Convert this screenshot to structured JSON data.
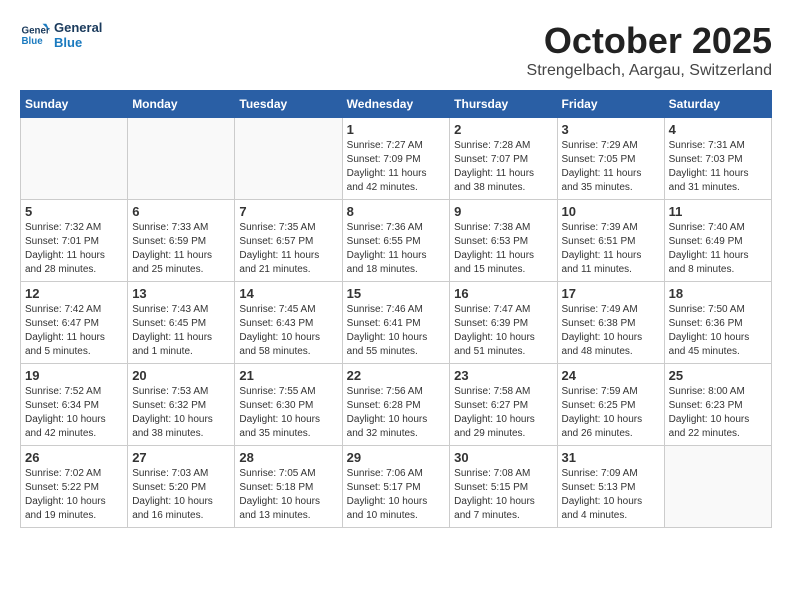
{
  "header": {
    "logo_line1": "General",
    "logo_line2": "Blue",
    "month": "October 2025",
    "location": "Strengelbach, Aargau, Switzerland"
  },
  "weekdays": [
    "Sunday",
    "Monday",
    "Tuesday",
    "Wednesday",
    "Thursday",
    "Friday",
    "Saturday"
  ],
  "weeks": [
    [
      {
        "day": "",
        "info": ""
      },
      {
        "day": "",
        "info": ""
      },
      {
        "day": "",
        "info": ""
      },
      {
        "day": "1",
        "info": "Sunrise: 7:27 AM\nSunset: 7:09 PM\nDaylight: 11 hours\nand 42 minutes."
      },
      {
        "day": "2",
        "info": "Sunrise: 7:28 AM\nSunset: 7:07 PM\nDaylight: 11 hours\nand 38 minutes."
      },
      {
        "day": "3",
        "info": "Sunrise: 7:29 AM\nSunset: 7:05 PM\nDaylight: 11 hours\nand 35 minutes."
      },
      {
        "day": "4",
        "info": "Sunrise: 7:31 AM\nSunset: 7:03 PM\nDaylight: 11 hours\nand 31 minutes."
      }
    ],
    [
      {
        "day": "5",
        "info": "Sunrise: 7:32 AM\nSunset: 7:01 PM\nDaylight: 11 hours\nand 28 minutes."
      },
      {
        "day": "6",
        "info": "Sunrise: 7:33 AM\nSunset: 6:59 PM\nDaylight: 11 hours\nand 25 minutes."
      },
      {
        "day": "7",
        "info": "Sunrise: 7:35 AM\nSunset: 6:57 PM\nDaylight: 11 hours\nand 21 minutes."
      },
      {
        "day": "8",
        "info": "Sunrise: 7:36 AM\nSunset: 6:55 PM\nDaylight: 11 hours\nand 18 minutes."
      },
      {
        "day": "9",
        "info": "Sunrise: 7:38 AM\nSunset: 6:53 PM\nDaylight: 11 hours\nand 15 minutes."
      },
      {
        "day": "10",
        "info": "Sunrise: 7:39 AM\nSunset: 6:51 PM\nDaylight: 11 hours\nand 11 minutes."
      },
      {
        "day": "11",
        "info": "Sunrise: 7:40 AM\nSunset: 6:49 PM\nDaylight: 11 hours\nand 8 minutes."
      }
    ],
    [
      {
        "day": "12",
        "info": "Sunrise: 7:42 AM\nSunset: 6:47 PM\nDaylight: 11 hours\nand 5 minutes."
      },
      {
        "day": "13",
        "info": "Sunrise: 7:43 AM\nSunset: 6:45 PM\nDaylight: 11 hours\nand 1 minute."
      },
      {
        "day": "14",
        "info": "Sunrise: 7:45 AM\nSunset: 6:43 PM\nDaylight: 10 hours\nand 58 minutes."
      },
      {
        "day": "15",
        "info": "Sunrise: 7:46 AM\nSunset: 6:41 PM\nDaylight: 10 hours\nand 55 minutes."
      },
      {
        "day": "16",
        "info": "Sunrise: 7:47 AM\nSunset: 6:39 PM\nDaylight: 10 hours\nand 51 minutes."
      },
      {
        "day": "17",
        "info": "Sunrise: 7:49 AM\nSunset: 6:38 PM\nDaylight: 10 hours\nand 48 minutes."
      },
      {
        "day": "18",
        "info": "Sunrise: 7:50 AM\nSunset: 6:36 PM\nDaylight: 10 hours\nand 45 minutes."
      }
    ],
    [
      {
        "day": "19",
        "info": "Sunrise: 7:52 AM\nSunset: 6:34 PM\nDaylight: 10 hours\nand 42 minutes."
      },
      {
        "day": "20",
        "info": "Sunrise: 7:53 AM\nSunset: 6:32 PM\nDaylight: 10 hours\nand 38 minutes."
      },
      {
        "day": "21",
        "info": "Sunrise: 7:55 AM\nSunset: 6:30 PM\nDaylight: 10 hours\nand 35 minutes."
      },
      {
        "day": "22",
        "info": "Sunrise: 7:56 AM\nSunset: 6:28 PM\nDaylight: 10 hours\nand 32 minutes."
      },
      {
        "day": "23",
        "info": "Sunrise: 7:58 AM\nSunset: 6:27 PM\nDaylight: 10 hours\nand 29 minutes."
      },
      {
        "day": "24",
        "info": "Sunrise: 7:59 AM\nSunset: 6:25 PM\nDaylight: 10 hours\nand 26 minutes."
      },
      {
        "day": "25",
        "info": "Sunrise: 8:00 AM\nSunset: 6:23 PM\nDaylight: 10 hours\nand 22 minutes."
      }
    ],
    [
      {
        "day": "26",
        "info": "Sunrise: 7:02 AM\nSunset: 5:22 PM\nDaylight: 10 hours\nand 19 minutes."
      },
      {
        "day": "27",
        "info": "Sunrise: 7:03 AM\nSunset: 5:20 PM\nDaylight: 10 hours\nand 16 minutes."
      },
      {
        "day": "28",
        "info": "Sunrise: 7:05 AM\nSunset: 5:18 PM\nDaylight: 10 hours\nand 13 minutes."
      },
      {
        "day": "29",
        "info": "Sunrise: 7:06 AM\nSunset: 5:17 PM\nDaylight: 10 hours\nand 10 minutes."
      },
      {
        "day": "30",
        "info": "Sunrise: 7:08 AM\nSunset: 5:15 PM\nDaylight: 10 hours\nand 7 minutes."
      },
      {
        "day": "31",
        "info": "Sunrise: 7:09 AM\nSunset: 5:13 PM\nDaylight: 10 hours\nand 4 minutes."
      },
      {
        "day": "",
        "info": ""
      }
    ]
  ]
}
